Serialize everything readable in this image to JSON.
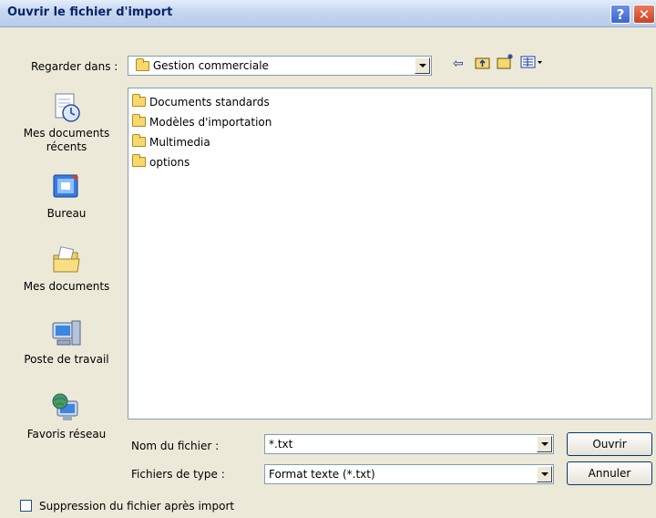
{
  "window": {
    "title": "Ouvrir le fichier d'import",
    "help_glyph": "?",
    "close_glyph": "✕"
  },
  "look_in": {
    "label": "Regarder dans :",
    "value": "Gestion commerciale"
  },
  "toolbar": {
    "icons": [
      "back-arrow-icon",
      "up-folder-icon",
      "new-folder-icon",
      "view-menu-icon"
    ]
  },
  "places": [
    {
      "label": "Mes documents récents",
      "icon": "recent-documents-icon"
    },
    {
      "label": "Bureau",
      "icon": "desktop-icon"
    },
    {
      "label": "Mes documents",
      "icon": "my-documents-icon"
    },
    {
      "label": "Poste de travail",
      "icon": "my-computer-icon"
    },
    {
      "label": "Favoris réseau",
      "icon": "network-places-icon"
    }
  ],
  "files": [
    {
      "name": "Documents standards"
    },
    {
      "name": "Modèles d'importation"
    },
    {
      "name": "Multimedia"
    },
    {
      "name": "options"
    }
  ],
  "filename": {
    "label": "Nom du fichier :",
    "value": "*.txt"
  },
  "filetype": {
    "label": "Fichiers de type :",
    "value": "Format texte (*.txt)"
  },
  "buttons": {
    "open": "Ouvrir",
    "cancel": "Annuler"
  },
  "delete_after_import": {
    "label": "Suppression du fichier après import",
    "checked": false
  }
}
